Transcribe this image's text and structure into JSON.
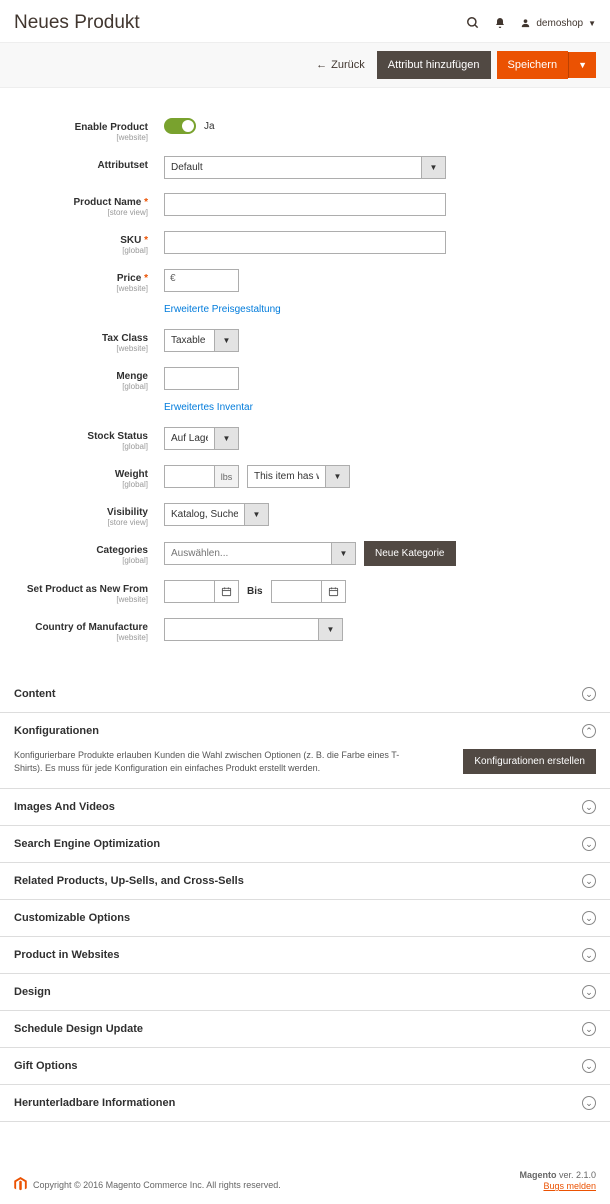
{
  "header": {
    "title": "Neues Produkt",
    "username": "demoshop"
  },
  "actions": {
    "back": "Zurück",
    "add_attr": "Attribut hinzufügen",
    "save": "Speichern"
  },
  "form": {
    "enable": {
      "label": "Enable Product",
      "scope": "[website]",
      "value": "Ja"
    },
    "attrset": {
      "label": "Attributset",
      "value": "Default"
    },
    "name": {
      "label": "Product Name",
      "scope": "[store view]"
    },
    "sku": {
      "label": "SKU",
      "scope": "[global]"
    },
    "price": {
      "label": "Price",
      "scope": "[website]",
      "currency": "€",
      "link": "Erweiterte Preisgestaltung"
    },
    "tax": {
      "label": "Tax Class",
      "scope": "[website]",
      "value": "Taxable Goods"
    },
    "qty": {
      "label": "Menge",
      "scope": "[global]",
      "link": "Erweitertes Inventar"
    },
    "stock": {
      "label": "Stock Status",
      "scope": "[global]",
      "value": "Auf Lager"
    },
    "weight": {
      "label": "Weight",
      "scope": "[global]",
      "unit": "lbs",
      "has": "This item has weight"
    },
    "vis": {
      "label": "Visibility",
      "scope": "[store view]",
      "value": "Katalog, Suche"
    },
    "cat": {
      "label": "Categories",
      "scope": "[global]",
      "placeholder": "Auswählen...",
      "new": "Neue Kategorie"
    },
    "newfrom": {
      "label": "Set Product as New From",
      "scope": "[website]",
      "to": "Bis"
    },
    "country": {
      "label": "Country of Manufacture",
      "scope": "[website]"
    }
  },
  "sections": {
    "content": "Content",
    "config": {
      "title": "Konfigurationen",
      "desc": "Konfigurierbare Produkte erlauben Kunden die Wahl zwischen Optionen (z. B. die Farbe eines T-Shirts). Es muss für jede Konfiguration ein einfaches Produkt erstellt werden.",
      "btn": "Konfigurationen erstellen"
    },
    "images": "Images And Videos",
    "seo": "Search Engine Optimization",
    "related": "Related Products, Up-Sells, and Cross-Sells",
    "options": "Customizable Options",
    "websites": "Product in Websites",
    "design": "Design",
    "schedule": "Schedule Design Update",
    "gift": "Gift Options",
    "download": "Herunterladbare Informationen"
  },
  "footer": {
    "copyright": "Copyright © 2016 Magento Commerce Inc. All rights reserved.",
    "product": "Magento",
    "version": " ver. 2.1.0",
    "bugs": "Bugs melden"
  }
}
